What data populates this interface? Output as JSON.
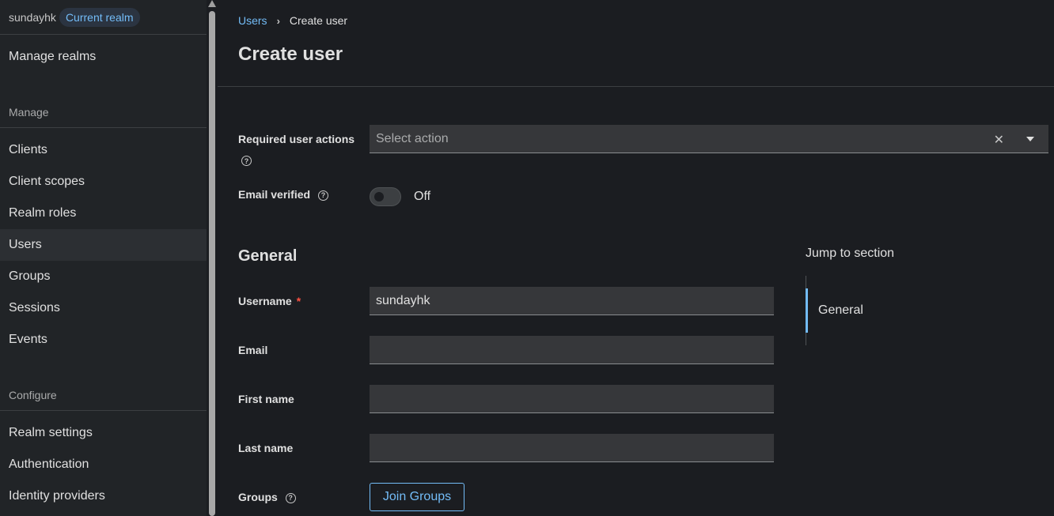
{
  "sidebar": {
    "realm_name": "sundayhk",
    "realm_badge": "Current realm",
    "manage_realms": "Manage realms",
    "manage_heading": "Manage",
    "manage_items": [
      "Clients",
      "Client scopes",
      "Realm roles",
      "Users",
      "Groups",
      "Sessions",
      "Events"
    ],
    "active_item": "Users",
    "configure_heading": "Configure",
    "configure_items": [
      "Realm settings",
      "Authentication",
      "Identity providers"
    ]
  },
  "breadcrumb": {
    "parent": "Users",
    "current": "Create user"
  },
  "page": {
    "title": "Create user"
  },
  "form": {
    "required_actions_label": "Required user actions",
    "required_actions_placeholder": "Select action",
    "email_verified_label": "Email verified",
    "email_verified_state": "Off",
    "general_title": "General",
    "username_label": "Username",
    "username_required": "*",
    "username_value": "sundayhk",
    "email_label": "Email",
    "email_value": "",
    "first_name_label": "First name",
    "first_name_value": "",
    "last_name_label": "Last name",
    "last_name_value": "",
    "groups_label": "Groups",
    "join_groups_button": "Join Groups"
  },
  "jump": {
    "title": "Jump to section",
    "items": [
      "General"
    ]
  },
  "icons": {
    "help": "?",
    "clear": "✕",
    "breadcrumb_separator": "›"
  },
  "colors": {
    "accent": "#73bcf7",
    "required": "#fe5142"
  }
}
